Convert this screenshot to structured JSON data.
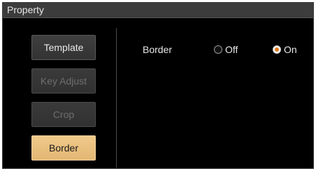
{
  "window": {
    "title": "Property"
  },
  "sidebar": {
    "items": [
      {
        "label": "Template",
        "state": "normal"
      },
      {
        "label": "Key Adjust",
        "state": "disabled"
      },
      {
        "label": "Crop",
        "state": "disabled"
      },
      {
        "label": "Border",
        "state": "active"
      }
    ]
  },
  "content": {
    "border_label": "Border",
    "options": [
      {
        "label": "Off",
        "selected": false
      },
      {
        "label": "On",
        "selected": true
      }
    ]
  },
  "colors": {
    "active_button": "#e9c07f",
    "radio_selected_dot": "#e07a1f",
    "background": "#000000",
    "title_bar": "#3c3c3c"
  }
}
